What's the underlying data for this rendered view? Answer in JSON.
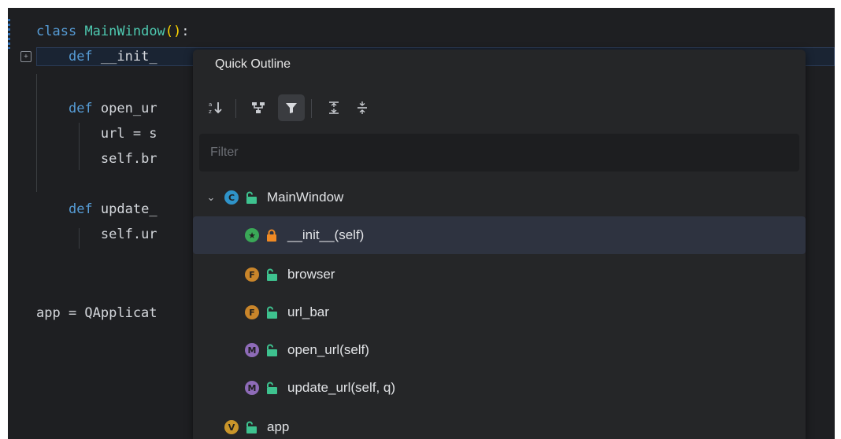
{
  "colors": {
    "editor_bg": "#1e1f22",
    "popup_bg": "#252628",
    "selected_row": "#2e3340",
    "keyword": "#569cd6",
    "class_name": "#4ec9b0",
    "paren": "#ffd700",
    "class_badge": "#2f93c9",
    "star_badge": "#3aa857",
    "field_badge": "#c9852a",
    "method_badge": "#8e6bb8",
    "var_badge": "#c9952a",
    "lock_open": "#3ec28f",
    "lock_closed": "#f08a24"
  },
  "editor": {
    "lines": [
      {
        "k": "class",
        "t": " ",
        "n": "MainWindow",
        "p": "()",
        "e": ":"
      },
      {
        "pre": "    ",
        "k": "def",
        "t": " __init_",
        "n": "",
        "p": "",
        "e": ""
      },
      {
        "pre": "    ",
        "k": "def",
        "t": " open_ur",
        "n": "",
        "p": "",
        "e": ""
      },
      {
        "pre": "        ",
        "k": "",
        "t": "url = s",
        "n": "",
        "p": "",
        "e": ""
      },
      {
        "pre": "        ",
        "k": "",
        "t": "self.br",
        "n": "",
        "p": "",
        "e": ""
      },
      {
        "pre": "    ",
        "k": "def",
        "t": " update_",
        "n": "",
        "p": "",
        "e": ""
      },
      {
        "pre": "        ",
        "k": "",
        "t": "self.ur",
        "n": "",
        "p": "",
        "e": ""
      },
      {
        "pre": "",
        "k": "",
        "t": "app = QApplicat",
        "n": "",
        "p": "",
        "e": ""
      }
    ]
  },
  "outline": {
    "title": "Quick Outline",
    "filter_placeholder": "Filter",
    "toolbar": {
      "buttons": [
        {
          "name": "sort-alpha-icon",
          "active": false
        },
        {
          "name": "hierarchy-icon",
          "active": false
        },
        {
          "name": "filter-icon",
          "active": true
        },
        {
          "name": "expand-all-icon",
          "active": false
        },
        {
          "name": "collapse-all-icon",
          "active": false
        }
      ]
    },
    "items": [
      {
        "label": "MainWindow",
        "badge": "C",
        "badge_type": "class",
        "lock": "open",
        "expanded": true,
        "level": 0
      },
      {
        "label": "__init__(self)",
        "badge": "★",
        "badge_type": "star",
        "lock": "closed",
        "level": 1,
        "selected": true
      },
      {
        "label": "browser",
        "badge": "F",
        "badge_type": "field",
        "lock": "open",
        "level": 1
      },
      {
        "label": "url_bar",
        "badge": "F",
        "badge_type": "field",
        "lock": "open",
        "level": 1
      },
      {
        "label": "open_url(self)",
        "badge": "M",
        "badge_type": "method",
        "lock": "open",
        "level": 1
      },
      {
        "label": "update_url(self, q)",
        "badge": "M",
        "badge_type": "method",
        "lock": "open",
        "level": 1
      },
      {
        "label": "app",
        "badge": "V",
        "badge_type": "var",
        "lock": "open",
        "level": 0
      }
    ]
  }
}
